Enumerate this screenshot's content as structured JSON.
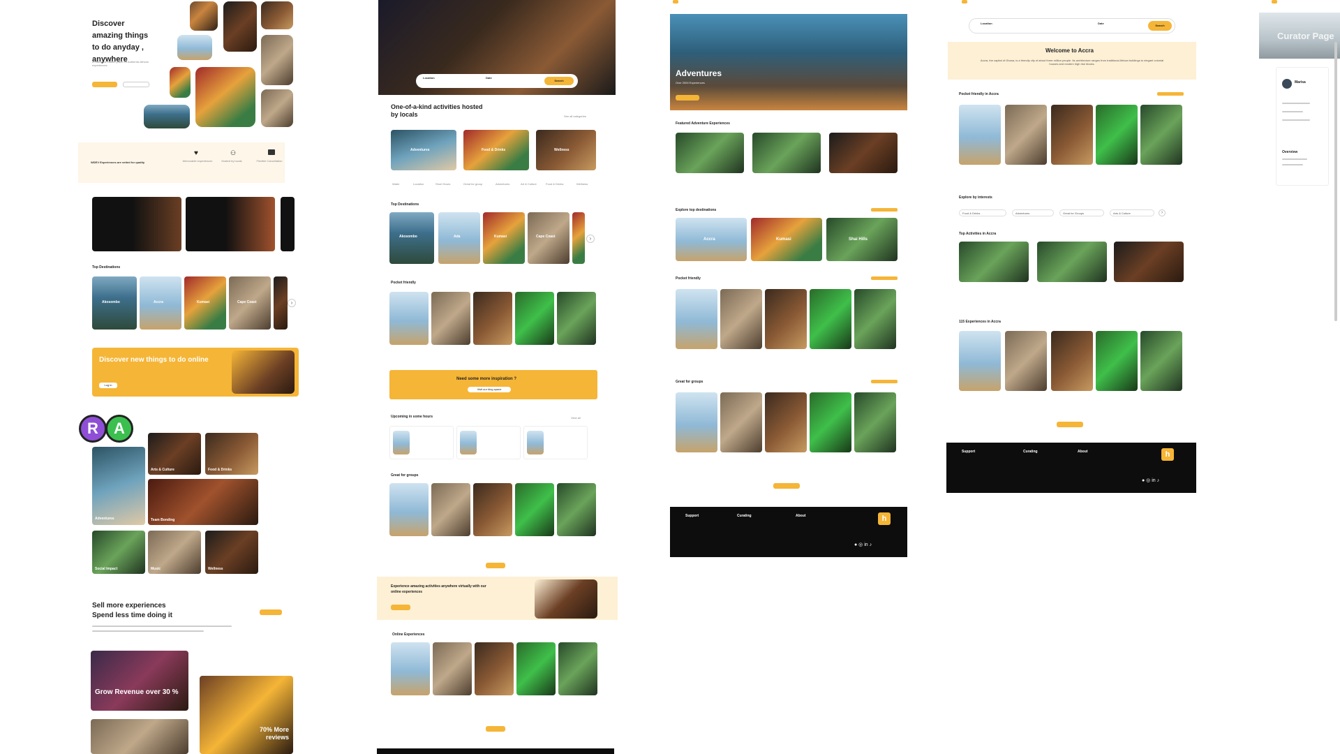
{
  "board1": {
    "hero_title": "Discover amazing things to do anyday , anywhere",
    "hero_sub": "A managed market place for Authentic African experiences",
    "badges": [
      {
        "icon": "heart-icon",
        "title": "Memorable experiences"
      },
      {
        "icon": "people-icon",
        "title": "Hosted by locals"
      },
      {
        "icon": "calendar-icon",
        "title": "Flexible Cancellation"
      }
    ],
    "badge_intro": "WDEV Experiences are vetted for quality",
    "top_destinations_label": "Top Destinations",
    "destinations": [
      "Akosombo",
      "Accra",
      "Kumasi",
      "Cape Coast"
    ],
    "promo_title": "Discover new things to do online",
    "promo_btn": "Log in",
    "avatar_r": "R",
    "avatar_a": "A",
    "interests": [
      "Arts & Culture",
      "Food & Drinks",
      "Adventures",
      "Team Bonding",
      "Social Impact",
      "Music",
      "Wellness"
    ],
    "sell_title_1": "Sell more experiences",
    "sell_title_2": "Spend less time doing it",
    "sell_btn": "Learn More",
    "growth_label": "Grow Revenue over 30 %",
    "reviews_label": "70% More reviews"
  },
  "board2": {
    "search_location": "Location",
    "search_date": "Date",
    "search_btn": "Search",
    "activities_title": "One-of-a-kind activities hosted by locals",
    "see_all": "See all categories",
    "categories": [
      "Adventures",
      "Food & Drinks",
      "Wellness"
    ],
    "filters": [
      "Water",
      "Location",
      "Short Hours",
      "Great for group",
      "Adventures",
      "Art & Culture",
      "Food & Drinks",
      "Wellness"
    ],
    "top_destinations_label": "Top Destinations",
    "destinations": [
      "Akosombo",
      "Ada",
      "Kumasi",
      "Cape Coast"
    ],
    "pocket_label": "Pocket friendly",
    "inspiration_title": "Need some more inspiration ?",
    "inspiration_btn": "Visit our blog space",
    "upcoming_label": "Upcoming in some hours",
    "upcoming_link": "View all",
    "groups_label": "Great for groups",
    "online_banner": "Experience amazing activities anywhere virtually with our online experiences",
    "online_label": "Online Experiences"
  },
  "board3": {
    "hero_title": "Adventures",
    "hero_sub": "Over 2000 Experiences",
    "featured_label": "Featured Adventure Experiences",
    "explore_label": "Explore top destinations",
    "destinations": [
      "Accra",
      "Kumasi",
      "Shai Hills"
    ],
    "pocket_label": "Pocket friendly",
    "groups_label": "Great for groups",
    "footer_cols": [
      "Support",
      "Curating",
      "About"
    ]
  },
  "board4": {
    "search_location": "Location",
    "search_date": "Date",
    "search_btn": "Search",
    "welcome_title": "Welcome to Accra",
    "welcome_body": "Accra, the capital of Ghana, is a friendly city of about three million people. Its architecture ranges from traditional African buildings to elegant colonial houses and modern high rise blocks.",
    "pocket_label": "Pocket friendly in Accra",
    "explore_label": "Explore by interests",
    "interests": [
      "Food & Drinks",
      "Adventures",
      "Great for Groups",
      "Arts & Culture"
    ],
    "top_label": "Top Activities in Accra",
    "experiences_label": "115 Experiences in Accra",
    "footer_cols": [
      "Support",
      "Curating",
      "About"
    ]
  },
  "board5": {
    "title": "Curator Page",
    "curator_name": "Marisa",
    "overview": "Overview"
  }
}
